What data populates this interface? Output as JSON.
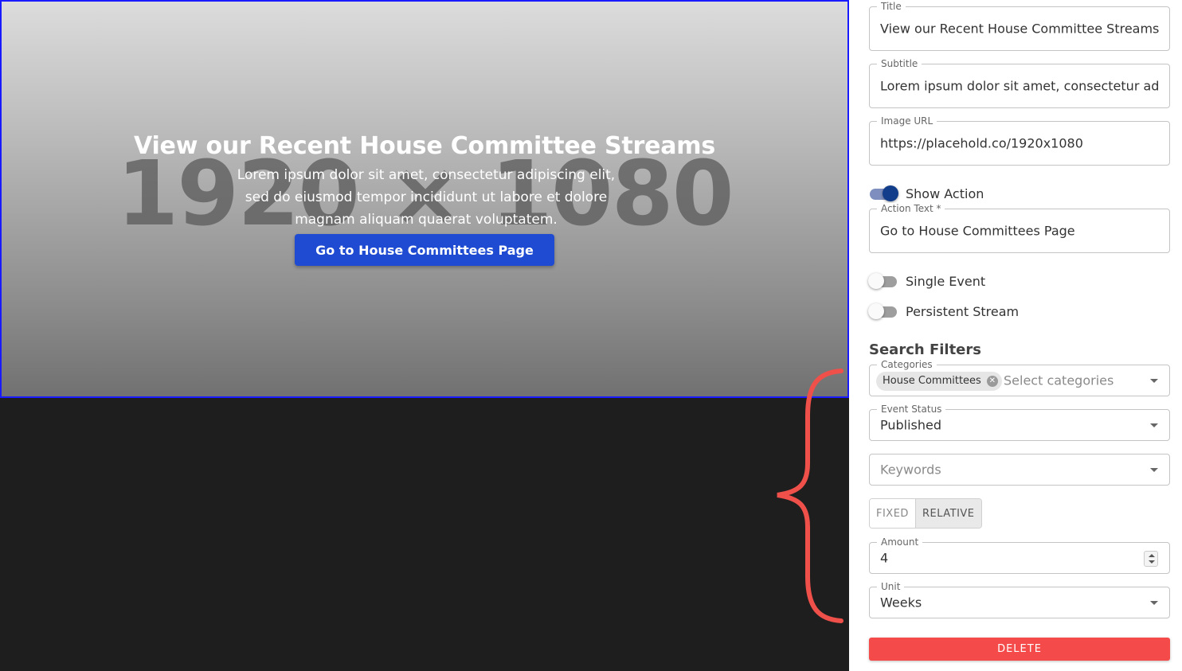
{
  "preview": {
    "placeholder_text": "1920 × 1080",
    "title": "View our Recent House Committee Streams",
    "subtitle": "Lorem ipsum dolor sit amet, consectetur adipiscing elit, sed do eiusmod tempor incididunt ut labore et dolore magnam aliquam quaerat voluptatem.",
    "action_label": "Go to House Committees Page",
    "button_color": "#1e4bd2"
  },
  "form": {
    "title": {
      "label": "Title",
      "value": "View our Recent House Committee Streams"
    },
    "subtitle": {
      "label": "Subtitle",
      "value": "Lorem ipsum dolor sit amet, consectetur adipiscing elit"
    },
    "image_url": {
      "label": "Image URL",
      "value": "https://placehold.co/1920x1080"
    },
    "show_action": {
      "label": "Show Action",
      "on": true
    },
    "action_text": {
      "label": "Action Text *",
      "value": "Go to House Committees Page"
    },
    "single_event": {
      "label": "Single Event",
      "on": false
    },
    "persistent_stream": {
      "label": "Persistent Stream",
      "on": false
    }
  },
  "search_filters": {
    "heading": "Search Filters",
    "categories": {
      "label": "Categories",
      "chip": "House Committees",
      "placeholder": "Select categories"
    },
    "event_status": {
      "label": "Event Status",
      "value": "Published"
    },
    "keywords": {
      "placeholder": "Keywords"
    },
    "date_mode": {
      "options": [
        "FIXED",
        "RELATIVE"
      ],
      "selected": "RELATIVE"
    },
    "amount": {
      "label": "Amount",
      "value": "4"
    },
    "unit": {
      "label": "Unit",
      "value": "Weeks"
    }
  },
  "delete_label": "DELETE",
  "delete_color": "#f44a4a",
  "accent_color": "#123d8a"
}
